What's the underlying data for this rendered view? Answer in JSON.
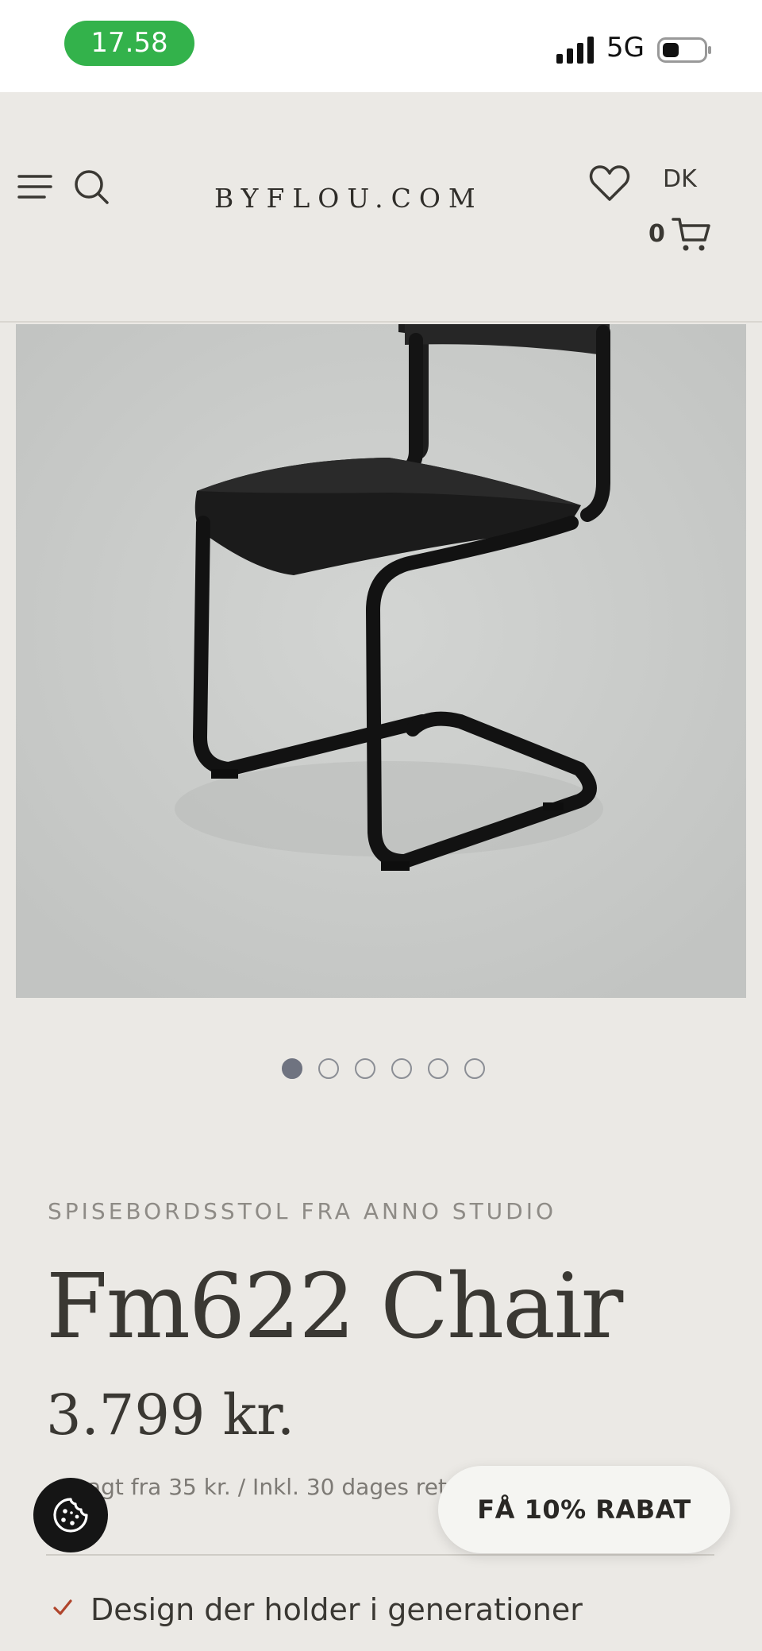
{
  "status_bar": {
    "time": "17.58",
    "network": "5G",
    "icons": [
      "signal-icon",
      "battery-icon"
    ]
  },
  "header": {
    "logo": "BYFLOU.COM",
    "language": "DK",
    "cart_count": "0",
    "icons": [
      "menu-icon",
      "search-icon",
      "heart-icon",
      "cart-icon"
    ]
  },
  "gallery": {
    "image_alt": "Fm622 Chair",
    "dot_count": 6,
    "active_index": 0
  },
  "product": {
    "subtitle": "SPISEBORDSSTOL FRA ANNO STUDIO",
    "name": "Fm622 Chair",
    "price": "3.799 kr.",
    "delivery_info": "agt fra 35 kr. / Inkl. 30 dages returret",
    "usps": [
      "Design der holder i generationer"
    ]
  },
  "floating": {
    "discount_label": "FÅ 10% RABAT",
    "cookie_icon": "cookie-icon"
  },
  "colors": {
    "background": "#ebe9e5",
    "status_pill": "#33b24b",
    "check_accent": "#b0452c"
  }
}
